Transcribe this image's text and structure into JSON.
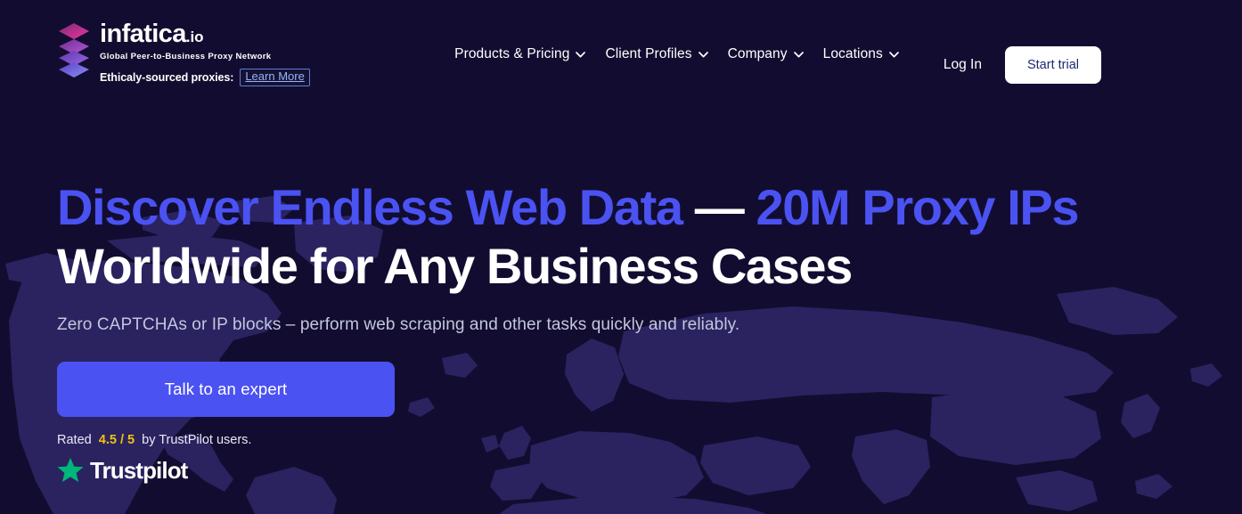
{
  "colors": {
    "background": "#120D30",
    "map_land": "#2A2360",
    "accent_blue": "#4B52F2",
    "white": "#FFFFFF",
    "rating_gold": "#F2C113",
    "trustpilot_green": "#00B67A",
    "link_blue": "#93B4F7",
    "start_trial_text": "#1E2A6E",
    "subtitle_grey": "#C3C6DD"
  },
  "header": {
    "logo": {
      "wordmark": "infatica",
      "tld": ".io",
      "tagline": "Global Peer-to-Business Proxy Network",
      "mark_icon": "stacked-diamonds-icon",
      "ethical_label": "Ethicaly-sourced proxies:",
      "learn_more_label": "Learn More"
    },
    "nav": [
      {
        "label": "Products & Pricing",
        "icon": "chevron-down-icon",
        "has_dropdown": true
      },
      {
        "label": "Client Profiles",
        "icon": "chevron-down-icon",
        "has_dropdown": true
      },
      {
        "label": "Company",
        "icon": "chevron-down-icon",
        "has_dropdown": true
      },
      {
        "label": "Locations",
        "icon": "chevron-down-icon",
        "has_dropdown": true
      }
    ],
    "login_label": "Log In",
    "start_trial_label": "Start trial"
  },
  "hero": {
    "headline_line1_part1": "Discover Endless Web Data",
    "headline_dash": "—",
    "headline_line1_part2": "20M Proxy IPs",
    "headline_line2": "Worldwide for Any Business Cases",
    "subtitle": "Zero CAPTCHAs or IP blocks – perform web scraping and other tasks quickly and reliably.",
    "cta_label": "Talk to an expert",
    "rating_prefix": "Rated",
    "rating_score": "4.5 / 5",
    "rating_suffix": "by TrustPilot users.",
    "trustpilot_label": "Trustpilot",
    "trustpilot_icon": "star-icon"
  }
}
